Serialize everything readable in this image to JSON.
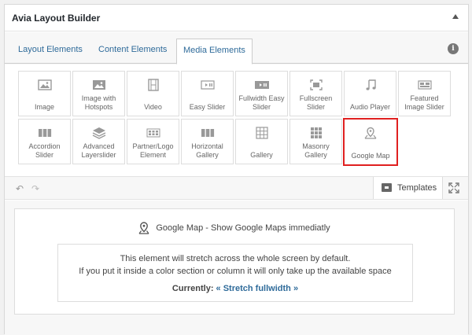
{
  "panel": {
    "title": "Avia Layout Builder"
  },
  "tabs": [
    {
      "label": "Layout Elements",
      "active": false
    },
    {
      "label": "Content Elements",
      "active": false
    },
    {
      "label": "Media Elements",
      "active": true
    }
  ],
  "tiles": [
    {
      "label": "Image",
      "icon": "image-icon"
    },
    {
      "label": "Image with Hotspots",
      "icon": "image-hotspots-icon"
    },
    {
      "label": "Video",
      "icon": "film-icon"
    },
    {
      "label": "Easy Slider",
      "icon": "slider-icon"
    },
    {
      "label": "Fullwidth Easy Slider",
      "icon": "fullwidth-slider-icon"
    },
    {
      "label": "Fullscreen Slider",
      "icon": "fullscreen-icon"
    },
    {
      "label": "Audio Player",
      "icon": "music-note-icon"
    },
    {
      "label": "Featured Image Slider",
      "icon": "featured-slider-icon"
    },
    {
      "label": "Accordion Slider",
      "icon": "accordion-icon"
    },
    {
      "label": "Advanced Layerslider",
      "icon": "layers-icon"
    },
    {
      "label": "Partner/Logo Element",
      "icon": "logo-grid-icon"
    },
    {
      "label": "Horizontal Gallery",
      "icon": "horizontal-gallery-icon"
    },
    {
      "label": "Gallery",
      "icon": "gallery-grid-icon"
    },
    {
      "label": "Masonry Gallery",
      "icon": "masonry-icon"
    },
    {
      "label": "Google Map",
      "icon": "map-pin-icon",
      "selected": true
    }
  ],
  "toolbar": {
    "templates_label": "Templates"
  },
  "element": {
    "title": "Google Map - Show Google Maps immediatly",
    "line1": "This element will stretch across the whole screen by default.",
    "line2": "If you put it inside a color section or column it will only take up the available space",
    "currently_label": "Currently:",
    "currently_value": "« Stretch fullwidth »"
  },
  "colors": {
    "accent": "#2f6b9a",
    "selected_border": "#e02020"
  }
}
